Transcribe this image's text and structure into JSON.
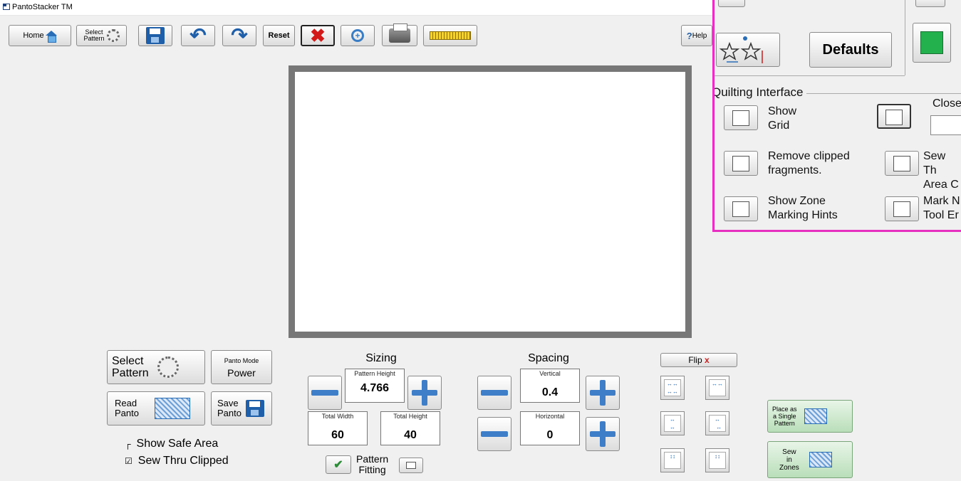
{
  "window": {
    "title": "PantoStacker TM"
  },
  "toolbar": {
    "home": "Home",
    "select_pattern_line1": "Select",
    "select_pattern_line2": "Pattern",
    "reset": "Reset",
    "help": "Help",
    "help_glyph": "?"
  },
  "panel": {
    "defaults": "Defaults",
    "section_title": "Quilting Interface",
    "show_grid": [
      "Show",
      "Grid"
    ],
    "remove_clipped": [
      "Remove clipped",
      "fragments."
    ],
    "show_zone": [
      "Show Zone",
      "Marking Hints"
    ],
    "close_label": "Close",
    "sew_thru": [
      "Sew Th",
      "Area C"
    ],
    "mark_n": [
      "Mark N",
      "Tool Er"
    ],
    "swatch_color": "#22b14c"
  },
  "left": {
    "select_pattern": [
      "Select",
      "Pattern"
    ],
    "panto_mode_caption": "Panto Mode",
    "panto_mode_value": "Power",
    "read_panto": [
      "Read",
      "Panto"
    ],
    "save_panto": [
      "Save",
      "Panto"
    ],
    "show_safe_area": "Show Safe Area",
    "sew_thru_clipped": "Sew Thru Clipped",
    "show_safe_area_glyph": "┌",
    "sew_thru_clipped_glyph": "☑"
  },
  "sizing": {
    "title": "Sizing",
    "pattern_height_caption": "Pattern Height",
    "pattern_height_value": "4.766",
    "total_width_caption": "Total Width",
    "total_width_value": "60",
    "total_height_caption": "Total Height",
    "total_height_value": "40",
    "pattern_fitting": [
      "Pattern",
      "Fitting"
    ]
  },
  "spacing": {
    "title": "Spacing",
    "vertical_caption": "Vertical",
    "vertical_value": "0.4",
    "horizontal_caption": "Horizontal",
    "horizontal_value": "0"
  },
  "flip": {
    "label": "Flip",
    "x": "x"
  },
  "place": {
    "single": [
      "Place as",
      "a Single",
      "Pattern"
    ],
    "zones": [
      "Sew",
      "in",
      "Zones"
    ]
  },
  "colors": {
    "accent_blue": "#3e7dc8",
    "panel_border": "#e631c0",
    "x_red": "#d21a1a"
  }
}
